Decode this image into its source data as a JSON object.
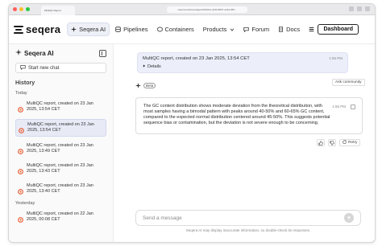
{
  "browser": {
    "tab_label": "MultiQC Report",
    "url": "seqera.io/ai/messages/9c0f2a1-4e6b-8807-ae3d-959..."
  },
  "nav": {
    "brand": "seqera",
    "items": [
      {
        "label": "Seqera AI",
        "icon": "sparkle-icon",
        "active": true
      },
      {
        "label": "Pipelines",
        "icon": "pipelines-icon"
      },
      {
        "label": "Containers",
        "icon": "containers-icon"
      },
      {
        "label": "Products",
        "icon": "chevron-down-icon"
      },
      {
        "label": "Forum",
        "icon": "forum-icon"
      },
      {
        "label": "Docs",
        "icon": "docs-icon"
      }
    ],
    "dashboard_label": "Dashboard"
  },
  "sidebar": {
    "title": "Seqera AI",
    "new_chat_label": "Start new chat",
    "history_label": "History",
    "groups": [
      {
        "label": "Today",
        "items": [
          {
            "text": "MultiQC report, created on 23 Jan 2025, 13:54 CET",
            "active": false
          },
          {
            "text": "MultiQC report, created on 23 Jan 2025, 13:54 CET",
            "active": true
          },
          {
            "text": "MultiQC report, created on 23 Jan 2025, 13:49 CET",
            "active": false
          },
          {
            "text": "MultiQC report, created on 23 Jan 2025, 13:43 CET",
            "active": false
          },
          {
            "text": "MultiQC report, created on 23 Jan 2025, 13:40 CET",
            "active": false
          }
        ]
      },
      {
        "label": "Yesterday",
        "items": [
          {
            "text": "MultiQC report, created on 22 Jan 2025, 00:08 CET",
            "active": false
          }
        ]
      }
    ]
  },
  "chat": {
    "user_message": "MultiQC report, created on 23 Jan 2025, 13:54 CET",
    "user_time": "1:55 PM",
    "details_label": "Details",
    "beta_label": "Beta",
    "ask_community_label": "Ask community",
    "bot_message": "The GC content distribution shows moderate deviation from the theoretical distribution, with most samples having a bimodal pattern with peaks around 40-50% and 60-65% GC content, compared to the expected normal distribution centered around 45-50%. This suggests potential sequence bias or contamination, but the deviation is not severe enough to be concerning.",
    "bot_time": "1:55 PM",
    "retry_label": "Retry",
    "composer_placeholder": "Send a message",
    "disclaimer": "Seqera AI may display inaccurate information, so double-check its responses."
  }
}
